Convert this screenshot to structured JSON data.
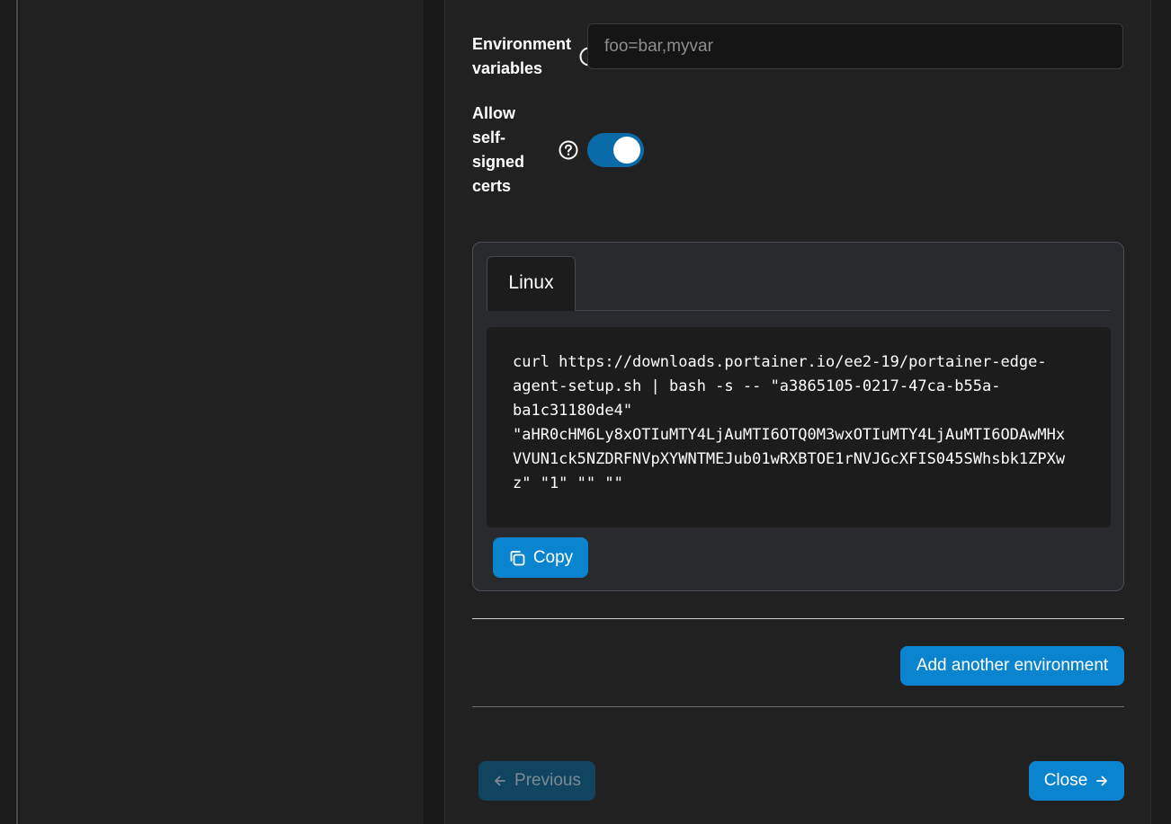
{
  "form": {
    "env_vars": {
      "label_line1": "Environment",
      "label_line2": "variables",
      "placeholder": "foo=bar,myvar",
      "value": ""
    },
    "self_signed": {
      "label_lines": [
        "Allow",
        "self-",
        "signed",
        "certs"
      ],
      "enabled": true
    }
  },
  "command_card": {
    "tabs": [
      "Linux"
    ],
    "active_tab": "Linux",
    "code_lines": [
      "curl https://downloads.portainer.io/ee2-19/portainer-edge-",
      "agent-setup.sh | bash -s -- \"a3865105-0217-47ca-b55a-",
      "ba1c31180de4\"",
      "\"aHR0cHM6Ly8xOTIuMTY4LjAuMTI6OTQ0M3wxOTIuMTY4LjAuMTI6ODAwMHx",
      "VVUN1ck5NZDRFNVpXYWNTMEJub01wRXBTOE1rNVJGcXFIS045SWhsbk1ZPXw",
      "z\" \"1\" \"\" \"\""
    ],
    "copy_label": "Copy"
  },
  "actions": {
    "add_environment_label": "Add another environment",
    "previous_label": "Previous",
    "close_label": "Close"
  },
  "colors": {
    "accent": "#0a84cf",
    "toggle_on": "#0b6aa8",
    "background": "#212121"
  }
}
